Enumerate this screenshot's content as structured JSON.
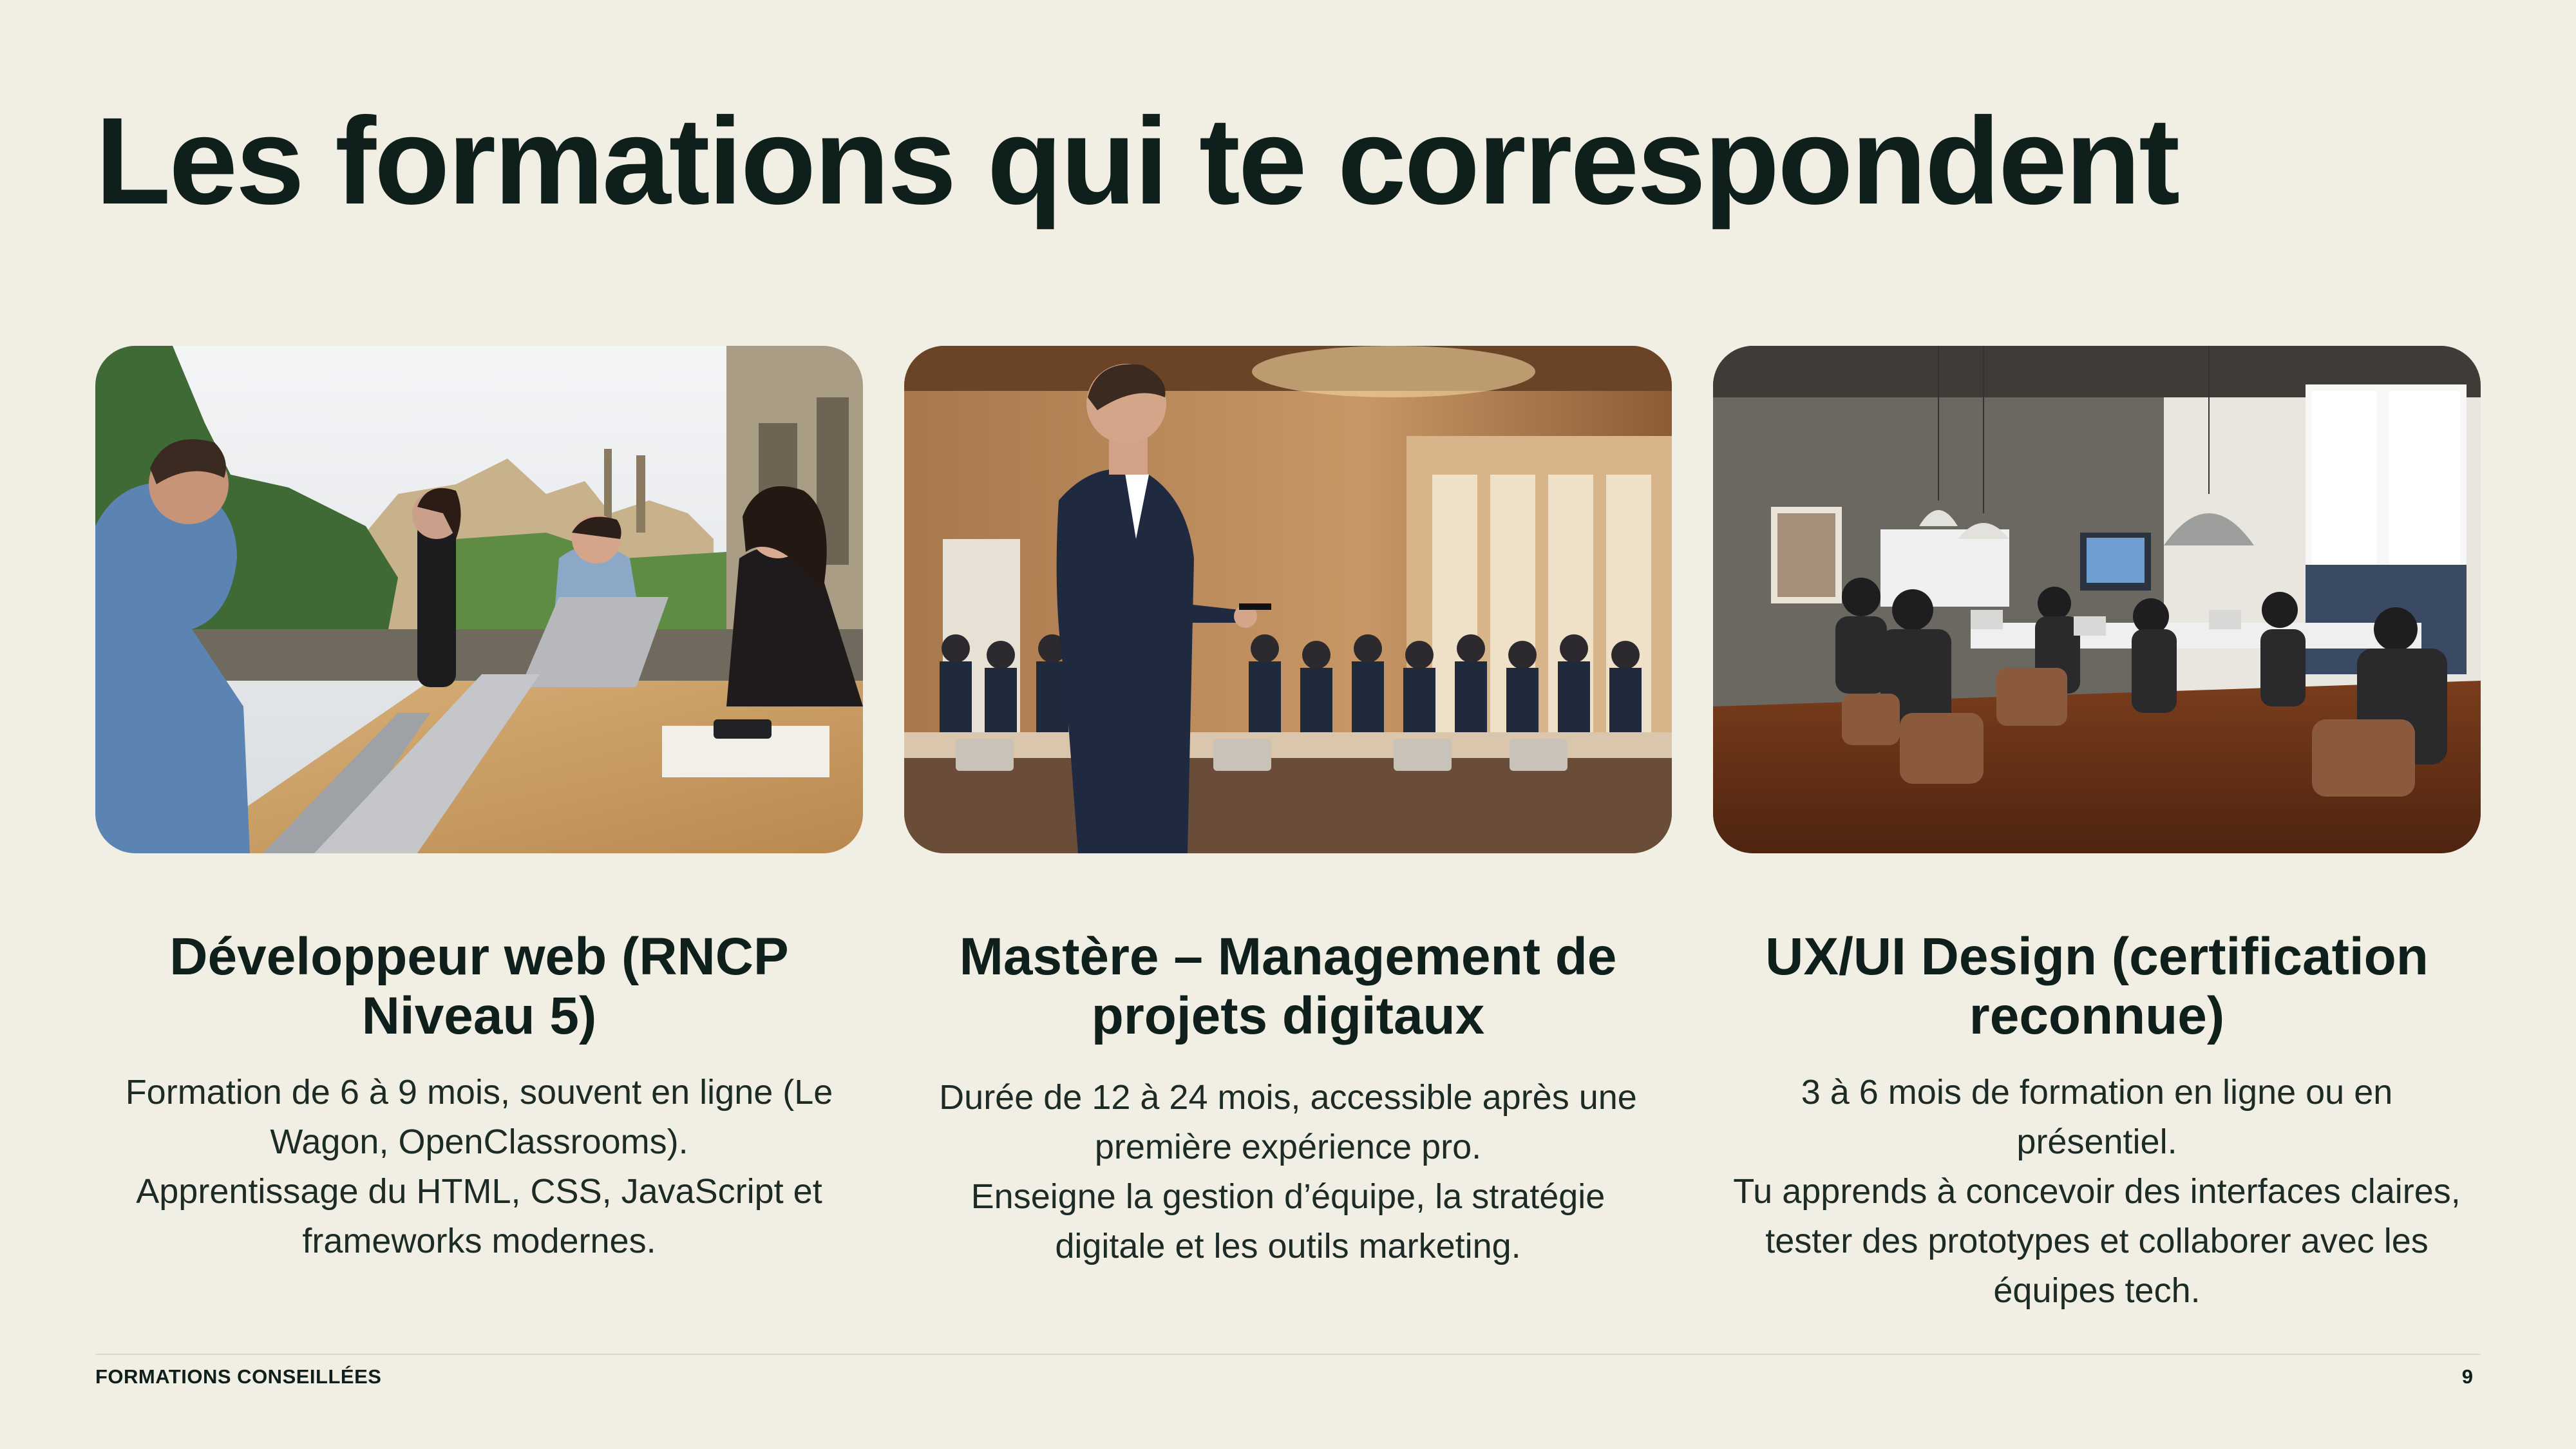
{
  "title": "Les formations qui te correspondent",
  "cards": [
    {
      "title_lines": [
        "Développeur web (RNCP",
        "Niveau 5)"
      ],
      "description_lines": [
        "Formation de 6 à 9 mois, souvent en ligne (Le",
        "Wagon, OpenClassrooms).",
        "Apprentissage du HTML, CSS, JavaScript et",
        "frameworks modernes."
      ]
    },
    {
      "title_lines": [
        "Mastère – Management de",
        "projets digitaux"
      ],
      "description_lines": [
        "Durée de 12 à 24 mois, accessible après une",
        "première expérience pro.",
        "Enseigne la gestion d’équipe, la stratégie",
        "digitale et les outils marketing."
      ]
    },
    {
      "title_lines": [
        "UX/UI Design (certification",
        "reconnue)"
      ],
      "description_lines": [
        "3 à 6 mois de formation en ligne ou en",
        "présentiel.",
        "Tu apprends à concevoir des interfaces claires,",
        "tester des prototypes et collaborer avec les",
        "équipes tech."
      ]
    }
  ],
  "footer": {
    "label": "FORMATIONS CONSEILLÉES",
    "page_number": "9"
  }
}
